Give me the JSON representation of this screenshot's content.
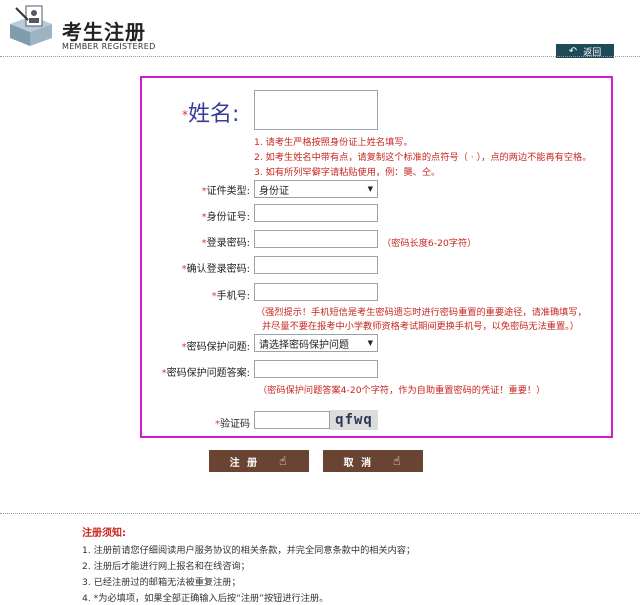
{
  "header": {
    "title": "考生注册",
    "subtitle": "MEMBER REGISTERED",
    "back_label": "返回"
  },
  "form": {
    "star": "*",
    "name": {
      "label": "姓名:",
      "hints": [
        "1. 请考生严格按照身份证上姓名填写。",
        "2. 如考生姓名中带有点，请复制这个标准的点符号（ · ），点的两边不能再有空格。",
        "3. 如有所列罕僻字请粘贴使用，例：龑、仝。"
      ]
    },
    "id_type": {
      "label": "证件类型:",
      "value": "身份证"
    },
    "id_number": {
      "label": "身份证号:"
    },
    "password": {
      "label": "登录密码:",
      "hint": "（密码长度6-20字符）"
    },
    "confirm_password": {
      "label": "确认登录密码:"
    },
    "phone": {
      "label": "手机号:",
      "hints": [
        "（强烈提示！手机短信是考生密码遗忘时进行密码重置的重要途径，请准确填写，",
        "并尽量不要在报考中小学教师资格考试期间更换手机号，以免密码无法重置。）"
      ]
    },
    "security_question": {
      "label": "密码保护问题:",
      "value": "请选择密码保护问题"
    },
    "security_answer": {
      "label": "密码保护问题答案:",
      "hint": "（密码保护问题答案4-20个字符，作为自助重置密码的凭证！重要！）"
    },
    "captcha": {
      "label": "验证码",
      "image_text": "qfwq"
    }
  },
  "buttons": {
    "register": "注 册",
    "cancel": "取 消"
  },
  "notice": {
    "title": "注册须知:",
    "items": [
      "1. 注册前请您仔细阅读用户服务协议的相关条款，并完全同意条款中的相关内容；",
      "2. 注册后才能进行网上报名和在线咨询；",
      "3. 已经注册过的邮箱无法被重复注册；",
      "4. *为必填项，如果全部正确输入后按“注册”按钮进行注册。"
    ]
  }
}
